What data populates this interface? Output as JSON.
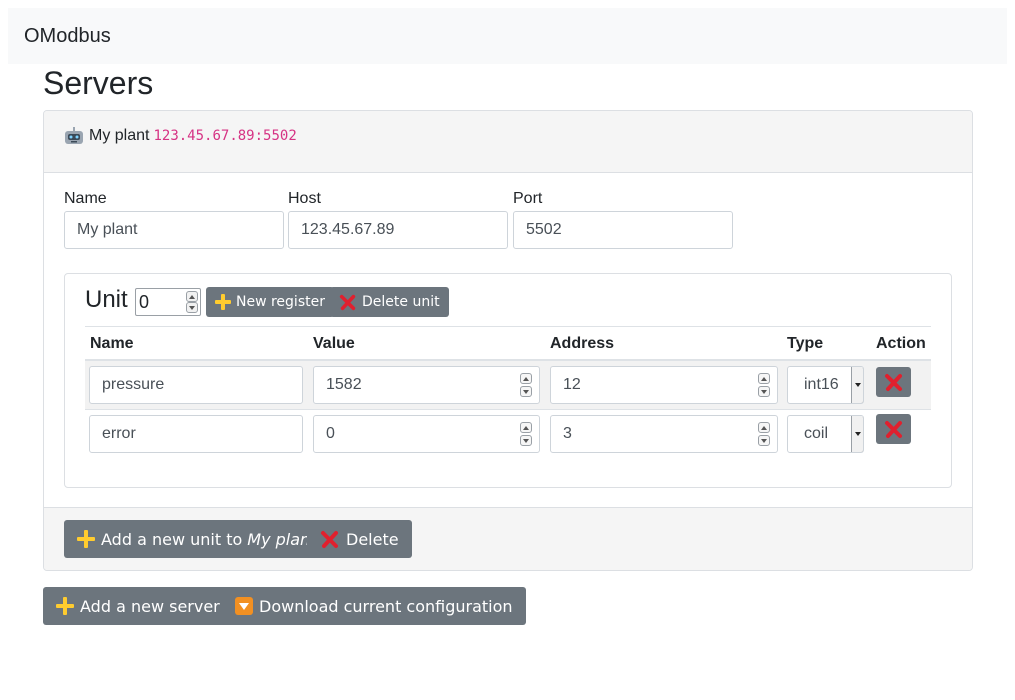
{
  "app": {
    "brand": "OModbus"
  },
  "page": {
    "title": "Servers"
  },
  "server": {
    "header_name": "My plant",
    "header_host": "123.45.67.89:5502",
    "fields": {
      "name_label": "Name",
      "name_value": "My plant",
      "host_label": "Host",
      "host_value": "123.45.67.89",
      "port_label": "Port",
      "port_value": "5502"
    },
    "unit": {
      "title": "Unit",
      "number": "0",
      "new_register_label": "New register",
      "delete_unit_label": "Delete unit",
      "columns": [
        "Name",
        "Value",
        "Address",
        "Type",
        "Action"
      ],
      "registers": [
        {
          "name": "pressure",
          "value": "1582",
          "address": "12",
          "type": "int16"
        },
        {
          "name": "error",
          "value": "0",
          "address": "3",
          "type": "coil"
        }
      ]
    },
    "footer": {
      "add_unit_prefix": "Add a new unit to",
      "add_unit_target": "My plant",
      "delete_label": "Delete"
    }
  },
  "actions": {
    "add_server_label": "Add a new server",
    "download_label": "Download current configuration"
  },
  "colors": {
    "button_bg": "#6c757d",
    "plus_icon": "#ffcc2f",
    "delete_icon": "#e0202e",
    "host_code": "#d63384",
    "download_icon": "#f29022"
  },
  "icons": [
    "robot-icon",
    "plus-icon",
    "cross-mark-icon",
    "down-arrow-button-icon"
  ]
}
